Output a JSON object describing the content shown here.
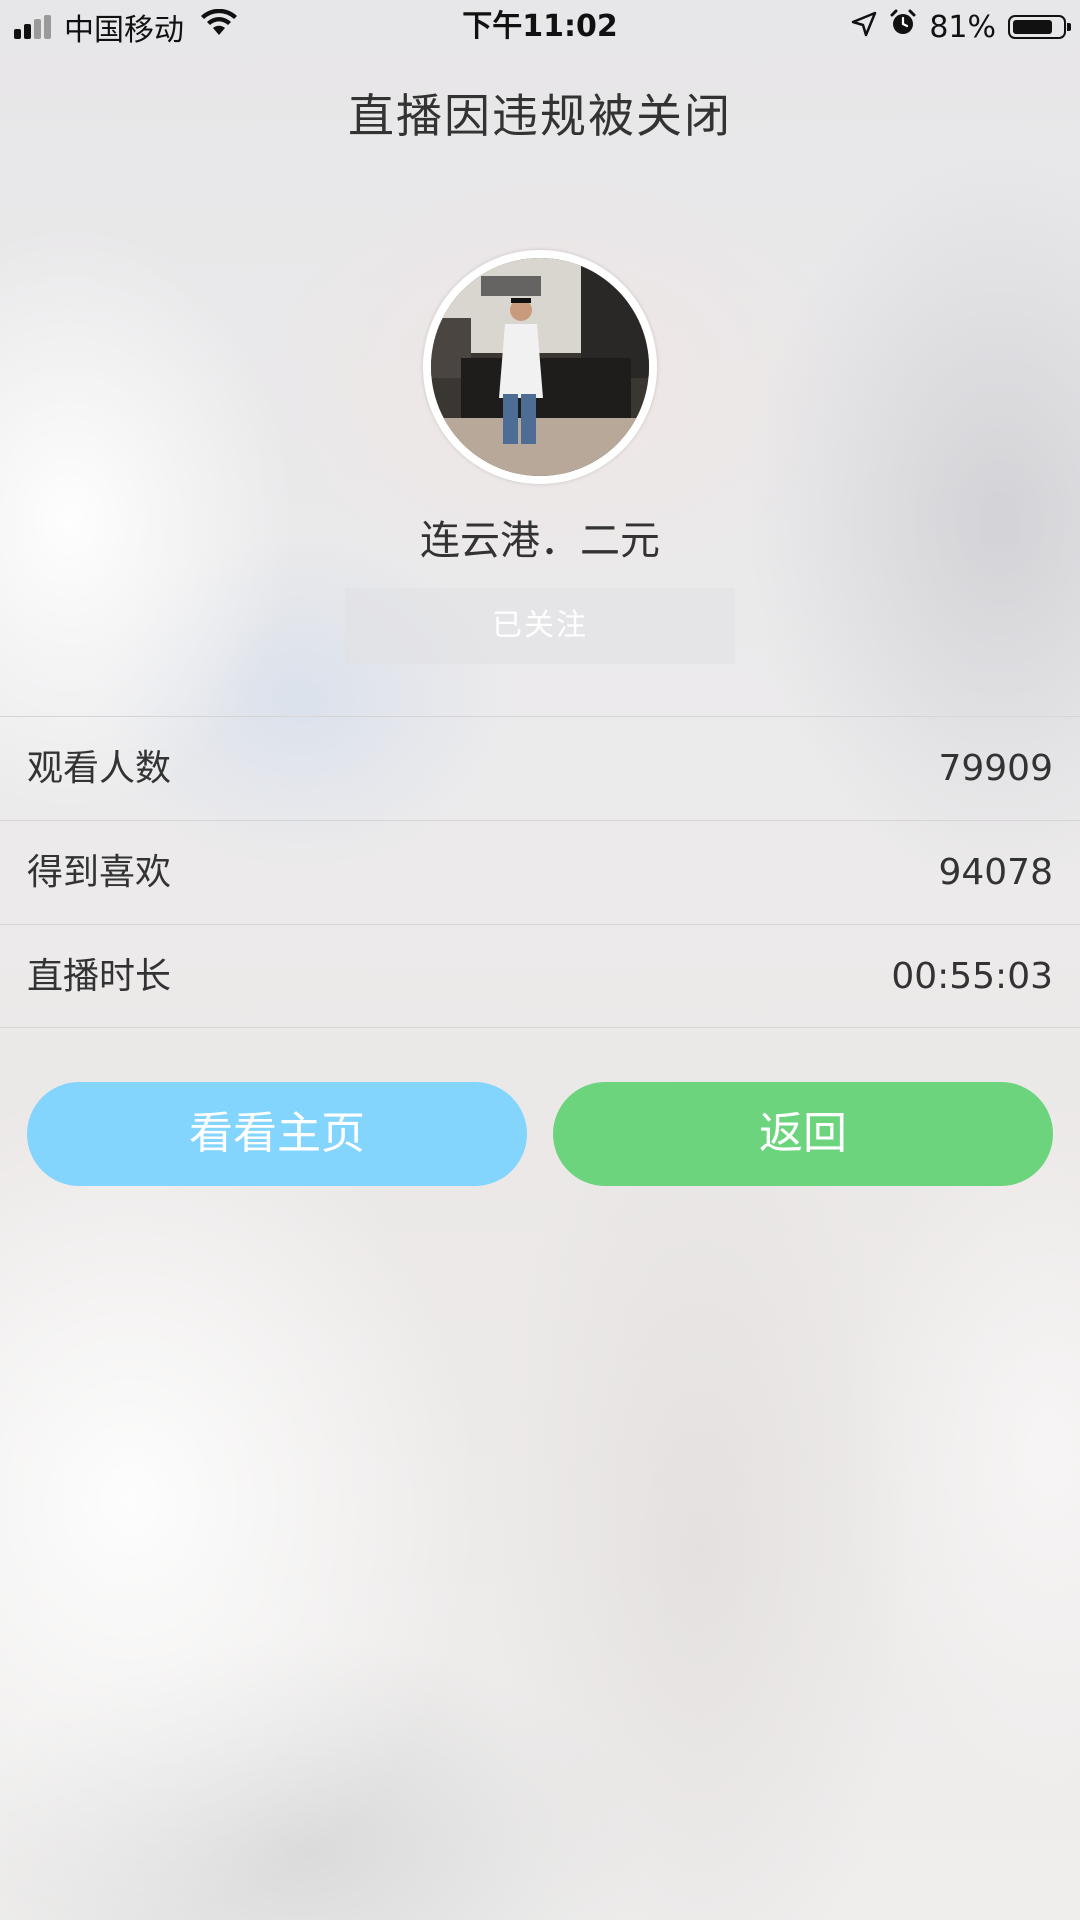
{
  "status_bar": {
    "carrier": "中国移动",
    "time": "下午11:02",
    "battery_percent": "81%",
    "battery_level": 0.81,
    "signal_bars": 4,
    "signal_strength": 2,
    "icons": [
      "signal-icon",
      "wifi-icon",
      "location-arrow-icon",
      "alarm-icon",
      "battery-icon"
    ]
  },
  "header": {
    "title": "直播因违规被关闭"
  },
  "profile": {
    "avatar": "avatar-photo",
    "name": "连云港．二元",
    "follow_label": "已关注"
  },
  "stats": [
    {
      "label": "观看人数",
      "value": "79909"
    },
    {
      "label": "得到喜欢",
      "value": "94078"
    },
    {
      "label": "直播时长",
      "value": "00:55:03"
    }
  ],
  "actions": {
    "home_label": "看看主页",
    "back_label": "返回",
    "home_color": "#83d5fd",
    "back_color": "#6bd47d"
  }
}
